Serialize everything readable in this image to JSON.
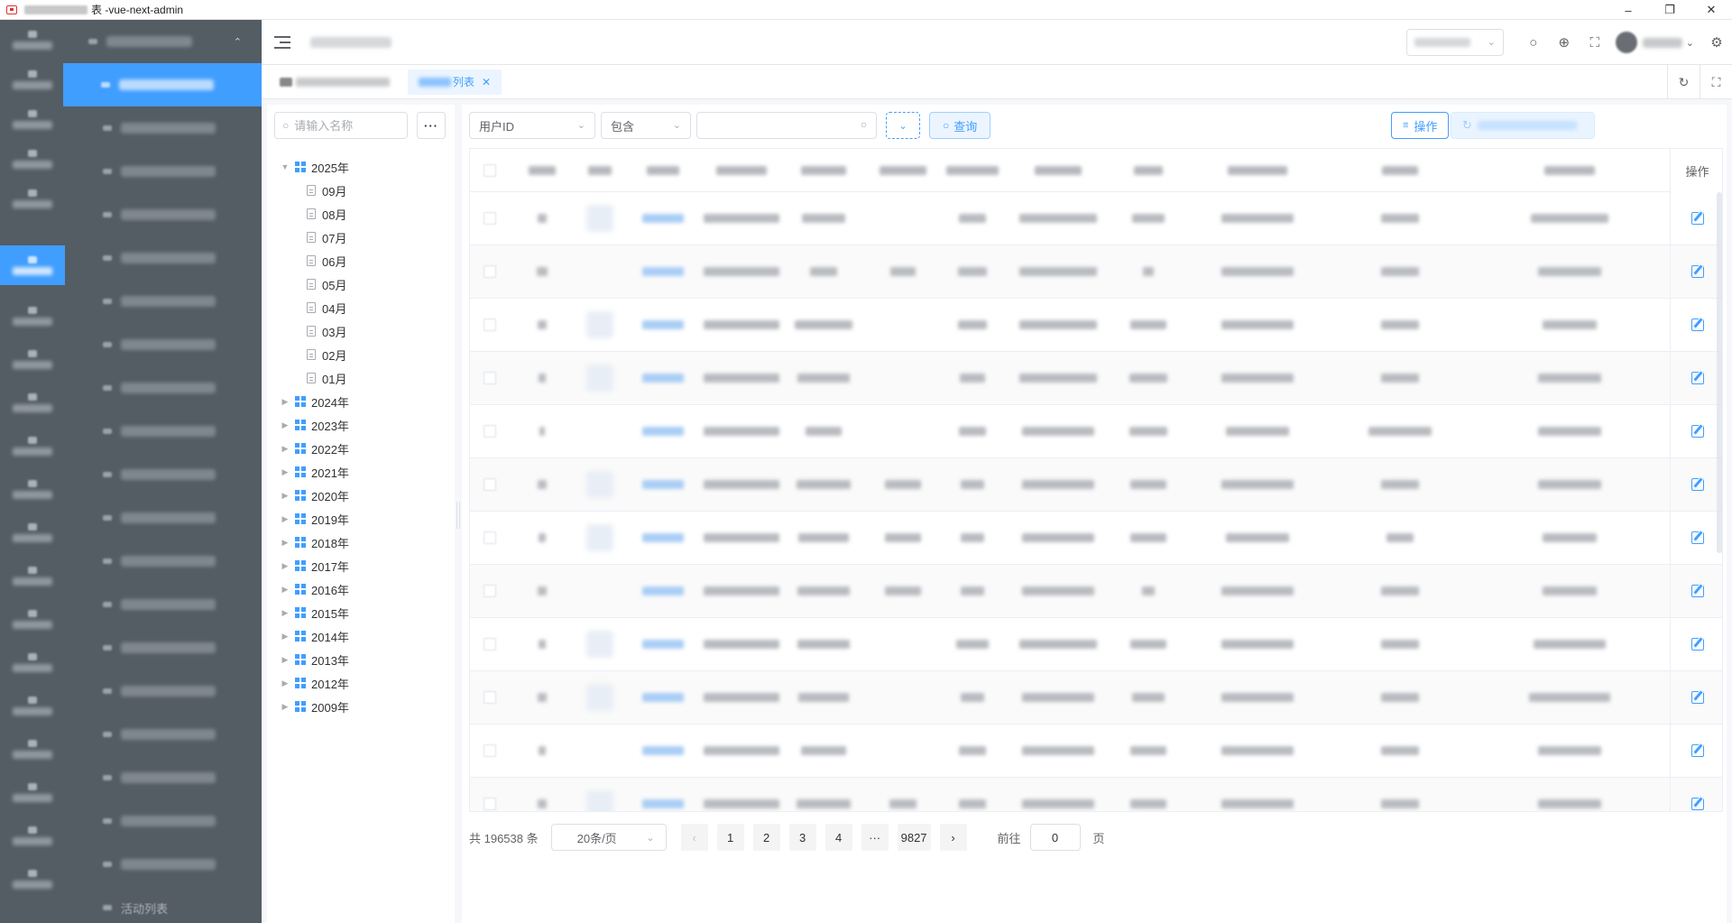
{
  "window": {
    "title": "vue-next-admin",
    "title_prefix": "表 - "
  },
  "sidebar": {
    "last_item_label": "活动列表"
  },
  "tags": {
    "active_tag_suffix": "列表"
  },
  "tree": {
    "search_placeholder": "请输入名称",
    "more_label": "···",
    "nodes": [
      {
        "label": "2025年",
        "expanded": true
      },
      {
        "label": "09月"
      },
      {
        "label": "08月"
      },
      {
        "label": "07月"
      },
      {
        "label": "06月"
      },
      {
        "label": "05月"
      },
      {
        "label": "04月"
      },
      {
        "label": "03月"
      },
      {
        "label": "02月"
      },
      {
        "label": "01月"
      },
      {
        "label": "2024年"
      },
      {
        "label": "2023年"
      },
      {
        "label": "2022年"
      },
      {
        "label": "2021年"
      },
      {
        "label": "2020年"
      },
      {
        "label": "2019年"
      },
      {
        "label": "2018年"
      },
      {
        "label": "2017年"
      },
      {
        "label": "2016年"
      },
      {
        "label": "2015年"
      },
      {
        "label": "2014年"
      },
      {
        "label": "2013年"
      },
      {
        "label": "2012年"
      },
      {
        "label": "2009年"
      }
    ]
  },
  "filters": {
    "field_value": "用户ID",
    "operator_value": "包含",
    "keyword_value": "",
    "query_label": "查询",
    "operate_label": "操作"
  },
  "table": {
    "op_header": "操作"
  },
  "pagination": {
    "total_text": "共 196538 条",
    "page_size": "20条/页",
    "pages": [
      "1",
      "2",
      "3",
      "4"
    ],
    "ellipsis": "···",
    "last_page": "9827",
    "goto_label": "前往",
    "goto_value": "0",
    "page_suffix": "页"
  }
}
